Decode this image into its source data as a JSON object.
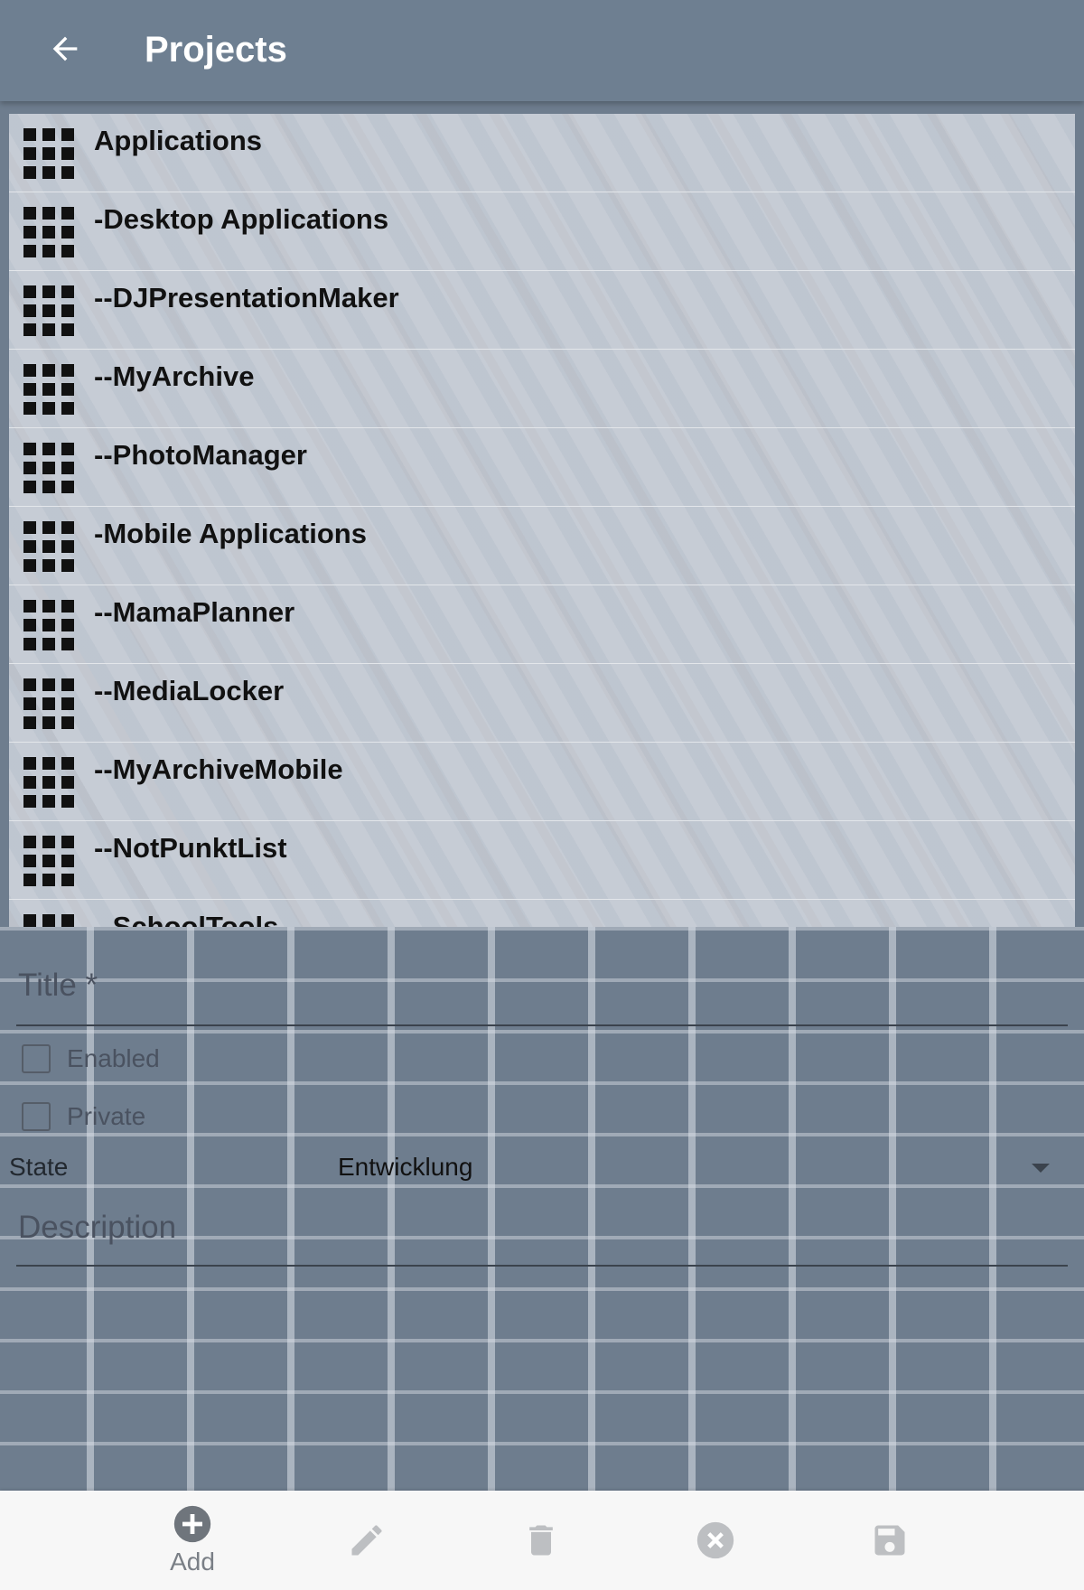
{
  "appbar": {
    "title": "Projects"
  },
  "projects": [
    "Applications",
    "-Desktop Applications",
    "--DJPresentationMaker",
    "--MyArchive",
    "--PhotoManager",
    "-Mobile Applications",
    "--MamaPlanner",
    "--MediaLocker",
    "--MyArchiveMobile",
    "--NotPunktList",
    "--SchoolTools"
  ],
  "form": {
    "title_placeholder": "Title *",
    "enabled_label": "Enabled",
    "private_label": "Private",
    "state_label": "State",
    "state_value": "Entwicklung",
    "description_placeholder": "Description"
  },
  "toolbar": {
    "add_label": "Add"
  },
  "colors": {
    "appbar": "#6e7f91",
    "list_bg": "#c6ccd5",
    "page_bg": "#6e7d8e",
    "toolbar_bg": "#f7f7f7",
    "icon_gray": "#8a8f96"
  },
  "icons": {
    "back": "arrow-left-icon",
    "item": "grid-icon",
    "add": "plus-circle-icon",
    "edit": "pencil-icon",
    "delete": "trash-icon",
    "cancel": "close-circle-icon",
    "save": "floppy-disk-icon"
  }
}
